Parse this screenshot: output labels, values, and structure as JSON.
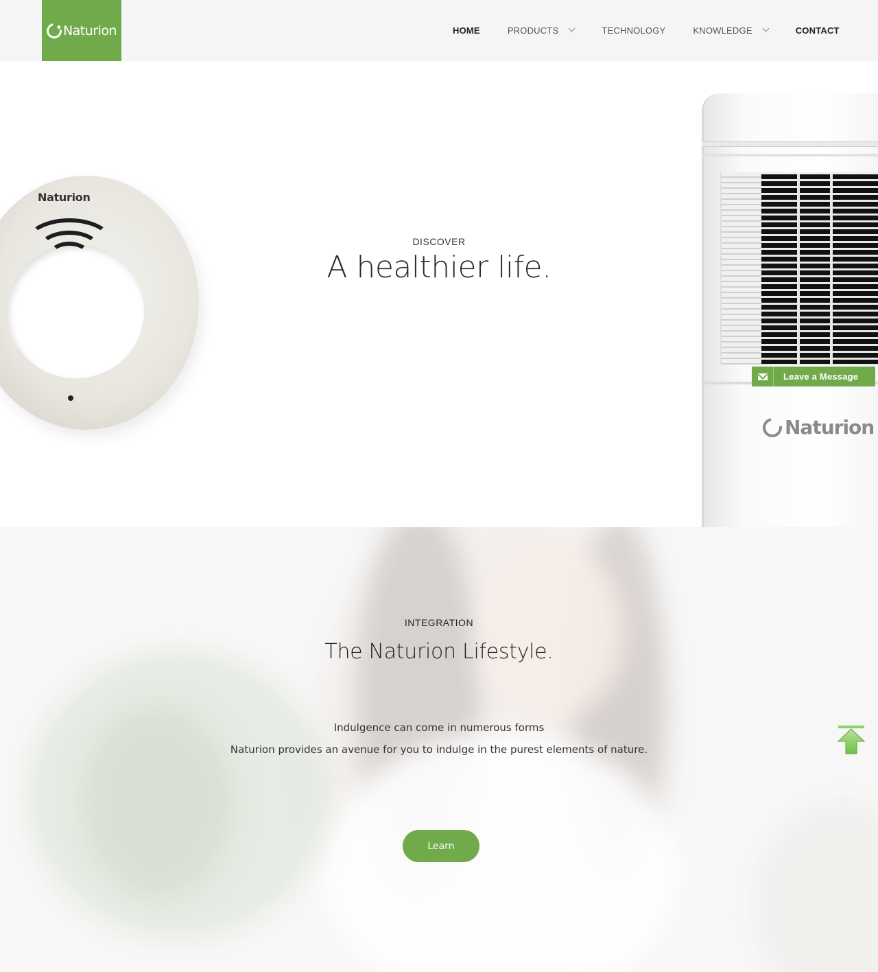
{
  "brand": {
    "name": "Naturion",
    "accent": "#71aa4b"
  },
  "nav": {
    "items": [
      {
        "label": "HOME",
        "has_dropdown": false
      },
      {
        "label": "PRODUCTS",
        "has_dropdown": true
      },
      {
        "label": "TECHNOLOGY",
        "has_dropdown": false
      },
      {
        "label": "KNOWLEDGE",
        "has_dropdown": true
      },
      {
        "label": "CONTACT",
        "has_dropdown": false
      }
    ]
  },
  "hero": {
    "eyebrow": "DISCOVER",
    "title": "A healthier life.",
    "ring_device_logo": "Naturion",
    "purifier_logo": "Naturion"
  },
  "message_widget": {
    "label": "Leave a Message",
    "icon": "envelope-icon"
  },
  "lifestyle": {
    "eyebrow": "INTEGRATION",
    "title": "The Naturion Lifestyle.",
    "line1": "Indulgence can come in numerous forms",
    "line2": "Naturion provides an avenue for you to indulge in the purest elements of nature.",
    "button_label": "Learn"
  },
  "back_to_top": {
    "icon": "arrow-up-icon"
  }
}
